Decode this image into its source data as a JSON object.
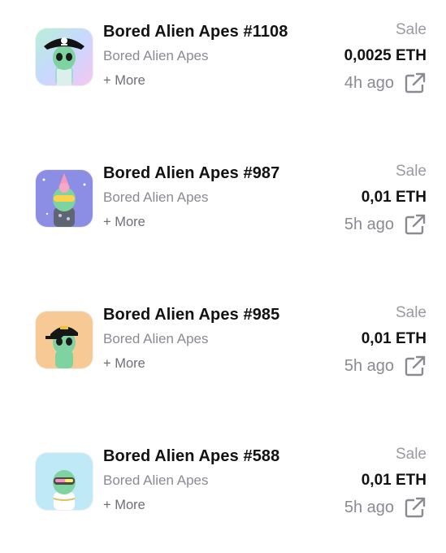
{
  "activity": [
    {
      "title": "Bored Alien Apes #1108",
      "collection": "Bored Alien Apes",
      "more": "+ More",
      "event": "Sale",
      "price": "0,0025 ETH",
      "age": "4h ago",
      "thumb": {
        "icon": "pirate-alien-ape-avatar",
        "bg": "#b8e8f0"
      }
    },
    {
      "title": "Bored Alien Apes #987",
      "collection": "Bored Alien Apes",
      "more": "+ More",
      "event": "Sale",
      "price": "0,01 ETH",
      "age": "5h ago",
      "thumb": {
        "icon": "ice-cream-alien-ape-avatar",
        "bg": "#8c8ee6"
      }
    },
    {
      "title": "Bored Alien Apes #985",
      "collection": "Bored Alien Apes",
      "more": "+ More",
      "event": "Sale",
      "price": "0,01 ETH",
      "age": "5h ago",
      "thumb": {
        "icon": "cap-alien-ape-avatar",
        "bg": "#f6c995"
      }
    },
    {
      "title": "Bored Alien Apes #588",
      "collection": "Bored Alien Apes",
      "more": "+ More",
      "event": "Sale",
      "price": "0,01 ETH",
      "age": "5h ago",
      "thumb": {
        "icon": "visor-alien-ape-avatar",
        "bg": "#bfe9f7"
      }
    }
  ],
  "colors": {
    "text_primary": "#121212",
    "text_secondary": "#8a8a93",
    "alien_green": "#7fd3a0"
  }
}
